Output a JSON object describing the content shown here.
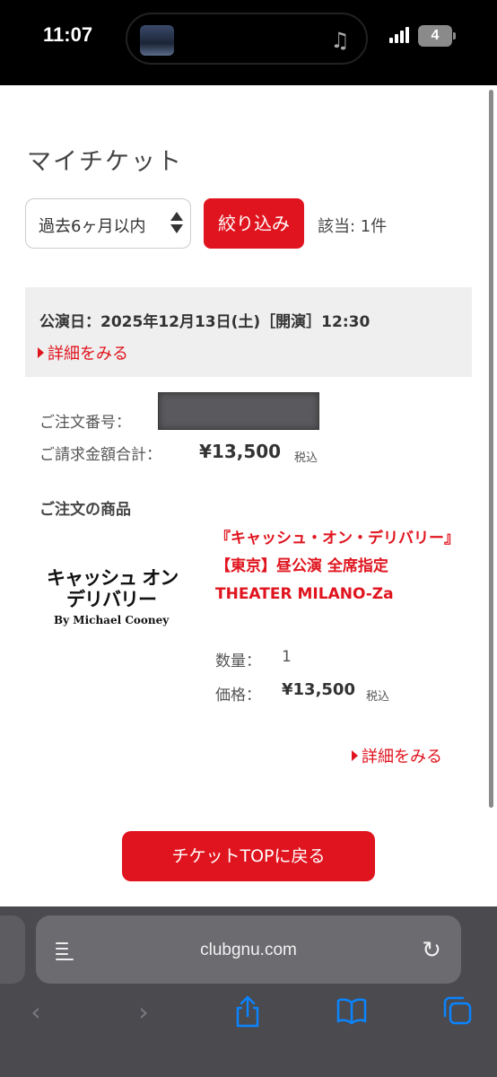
{
  "status_bar": {
    "time": "11:07",
    "battery": "4"
  },
  "page": {
    "title": "マイチケット"
  },
  "filter": {
    "period_selected": "過去6ヶ月以内",
    "button_label": "絞り込み",
    "count_text": "該当: 1件"
  },
  "performance": {
    "date_text": "公演日：2025年12月13日(土)［開演］12:30",
    "detail_link": "詳細をみる"
  },
  "order": {
    "order_number_label": "ご注文番号：",
    "total_label": "ご請求金額合計：",
    "total_value": "¥13,500",
    "tax_note": "税込"
  },
  "items_section": {
    "title": "ご注文の商品"
  },
  "product": {
    "logo_line1": "キャッシュ オン",
    "logo_line2": "デリバリー",
    "logo_line3": "By Michael Cooney",
    "name": "『キャッシュ・オン・デリバリー』【東京】昼公演 全席指定 THEATER MILANO-Za",
    "quantity_label": "数量：",
    "quantity_value": "1",
    "price_label": "価格：",
    "price_value": "¥13,500",
    "tax_note": "税込",
    "detail_link": "詳細をみる"
  },
  "buttons": {
    "ticket_top": "チケットTOPに戻る"
  },
  "browser": {
    "url": "clubgnu.com"
  },
  "colors": {
    "accent": "#e0141e",
    "link_blue": "#0a84ff"
  }
}
